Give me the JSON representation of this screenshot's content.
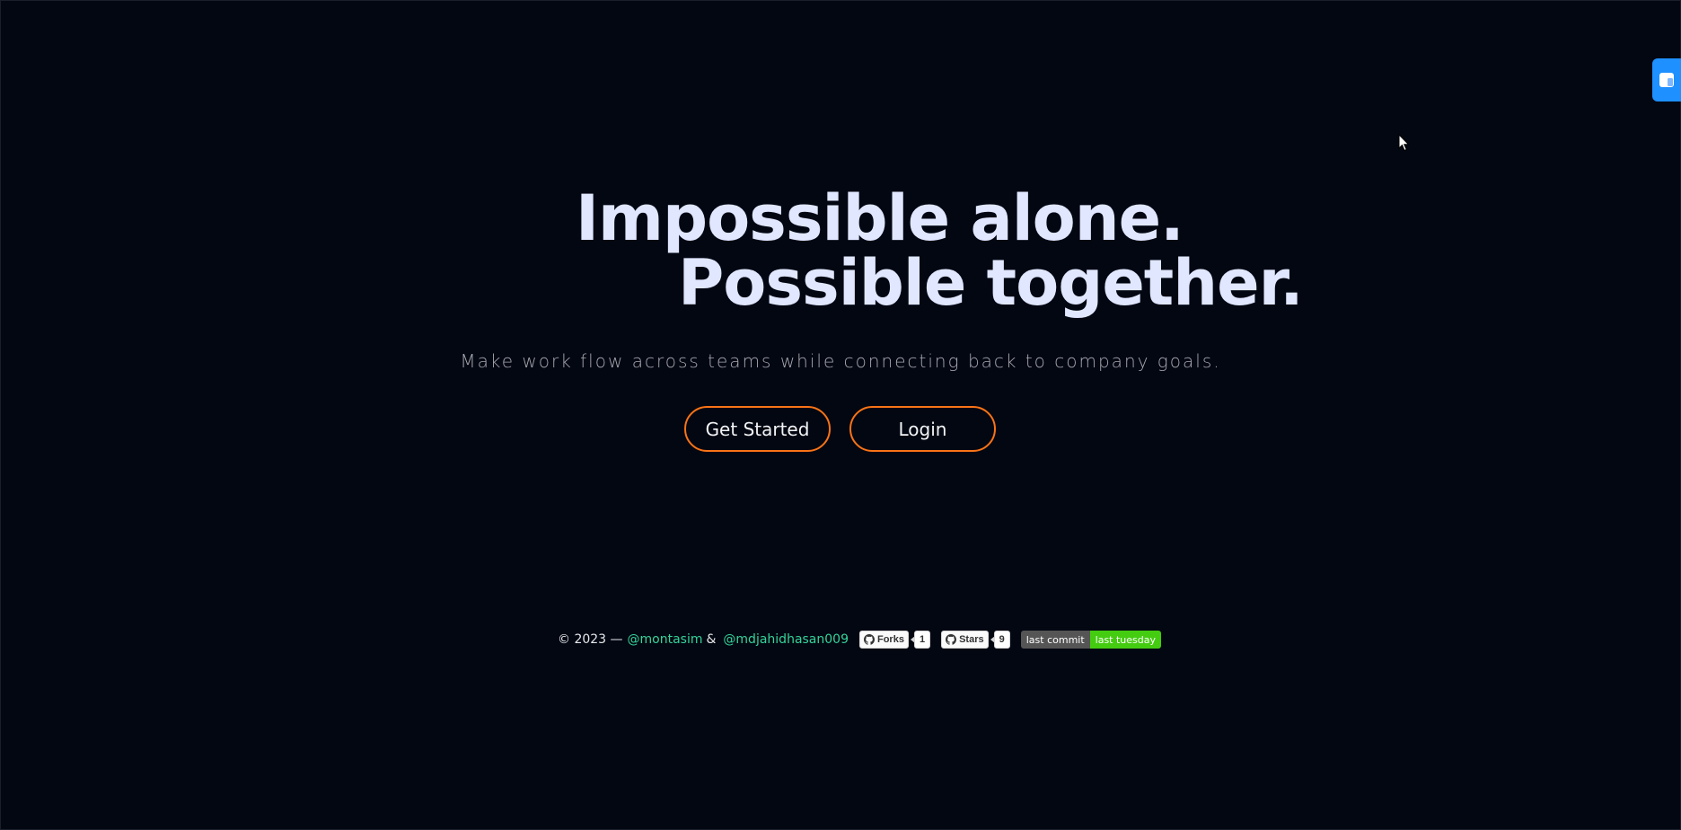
{
  "hero": {
    "headline_line1": "Impossible alone.",
    "headline_line2": "Possible together.",
    "subtitle": "Make work flow across teams while connecting back to company goals."
  },
  "actions": {
    "get_started_label": "Get Started",
    "login_label": "Login"
  },
  "footer": {
    "copyright": "© 2023 —",
    "author1": "@montasim",
    "ampersand": "&",
    "author2": "@mdjahidhasan009",
    "forks_label": "Forks",
    "forks_count": "1",
    "stars_label": "Stars",
    "stars_count": "9",
    "last_commit_label": "last commit",
    "last_commit_value": "last tuesday"
  },
  "icons": {
    "github": "github-icon",
    "side_tab": "extension-panel-icon",
    "cursor": "mouse-pointer-icon"
  },
  "colors": {
    "background": "#030712",
    "headline": "#e0e7ff",
    "accent_border": "#f97316",
    "link": "#34d399",
    "side_tab": "#1e90ff",
    "shield_value": "#44cc11"
  }
}
